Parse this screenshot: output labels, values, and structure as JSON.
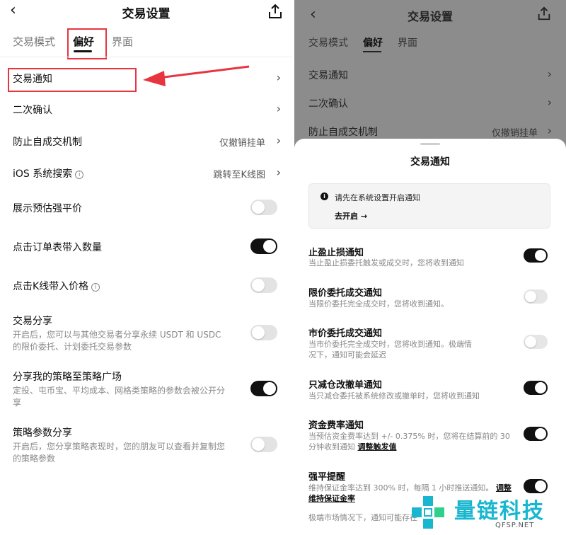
{
  "left": {
    "nav": {
      "back": "‹",
      "title": "交易设置"
    },
    "tabs": [
      {
        "label": "交易模式",
        "active": false
      },
      {
        "label": "偏好",
        "active": true
      },
      {
        "label": "界面",
        "active": false
      }
    ],
    "rows": {
      "trade_notify": {
        "label": "交易通知"
      },
      "double_confirm": {
        "label": "二次确认"
      },
      "self_trade": {
        "label": "防止自成交机制",
        "value": "仅撤销挂单"
      },
      "ios_search": {
        "label": "iOS 系统搜索",
        "info": "i",
        "value": "跳转至K线图"
      },
      "liq_price": {
        "label": "展示预估强平价",
        "toggle": "off"
      },
      "order_qty": {
        "label": "点击订单表带入数量",
        "toggle": "on"
      },
      "kline_price": {
        "label": "点击K线带入价格",
        "info": "i",
        "toggle": "off"
      },
      "trade_share": {
        "label": "交易分享",
        "sub": "开启后，您可以与其他交易者分享永续 USDT 和 USDC 的限价委托、计划委托交易参数",
        "toggle": "off"
      },
      "strategy_square": {
        "label": "分享我的策略至策略广场",
        "sub": "定投、屯币宝、平均成本、网格类策略的参数会被公开分享",
        "toggle": "on"
      },
      "strategy_param": {
        "label": "策略参数分享",
        "sub": "开启后，您分享策略表现时，您的朋友可以查看并复制您的策略参数",
        "toggle": "off"
      }
    }
  },
  "right": {
    "nav": {
      "back": "‹",
      "title": "交易设置"
    },
    "tabs": [
      "交易模式",
      "偏好",
      "界面"
    ],
    "rows": [
      {
        "label": "交易通知"
      },
      {
        "label": "二次确认"
      },
      {
        "label": "防止自成交机制",
        "value": "仅撤销挂单"
      }
    ],
    "sheet": {
      "title": "交易通知",
      "notice": {
        "icon": "i",
        "text": "请先在系统设置开启通知",
        "link": "去开启 →"
      },
      "items": [
        {
          "label": "止盈止损通知",
          "sub": "当止盈止损委托触发或成交时，您将收到通知",
          "toggle": "on"
        },
        {
          "label": "限价委托成交通知",
          "sub": "当限价委托完全成交时，您将收到通知。",
          "toggle": "off"
        },
        {
          "label": "市价委托成交通知",
          "sub": "当市价委托完全成交时，您将收到通知。极端情况下，通知可能会延迟",
          "toggle": "off"
        },
        {
          "label": "只减仓改撤单通知",
          "sub": "当只减仓委托被系统修改或撤单时，您将收到通知",
          "toggle": "on"
        },
        {
          "label": "资金费率通知",
          "sub": "当预估资金费率达到 +/- 0.375% 时，您将在结算前的 30 分钟收到通知",
          "link": "调整触发值",
          "toggle": "on"
        },
        {
          "label": "强平提醒",
          "sub": "维持保证金率达到 300% 时，每隔 1 小时推送通知。",
          "link": "调整维持保证金率",
          "toggle": "on"
        }
      ],
      "footer": "极端市场情况下，通知可能存在"
    }
  },
  "watermark": {
    "text": "量链科技",
    "domain": "QFSP.NET"
  },
  "colors": {
    "highlight": "#e8343f",
    "toggle_on": "#111111",
    "toggle_off": "#e3e3e3",
    "overlay": "#8c8c8c",
    "watermark": "#19b7cf"
  }
}
